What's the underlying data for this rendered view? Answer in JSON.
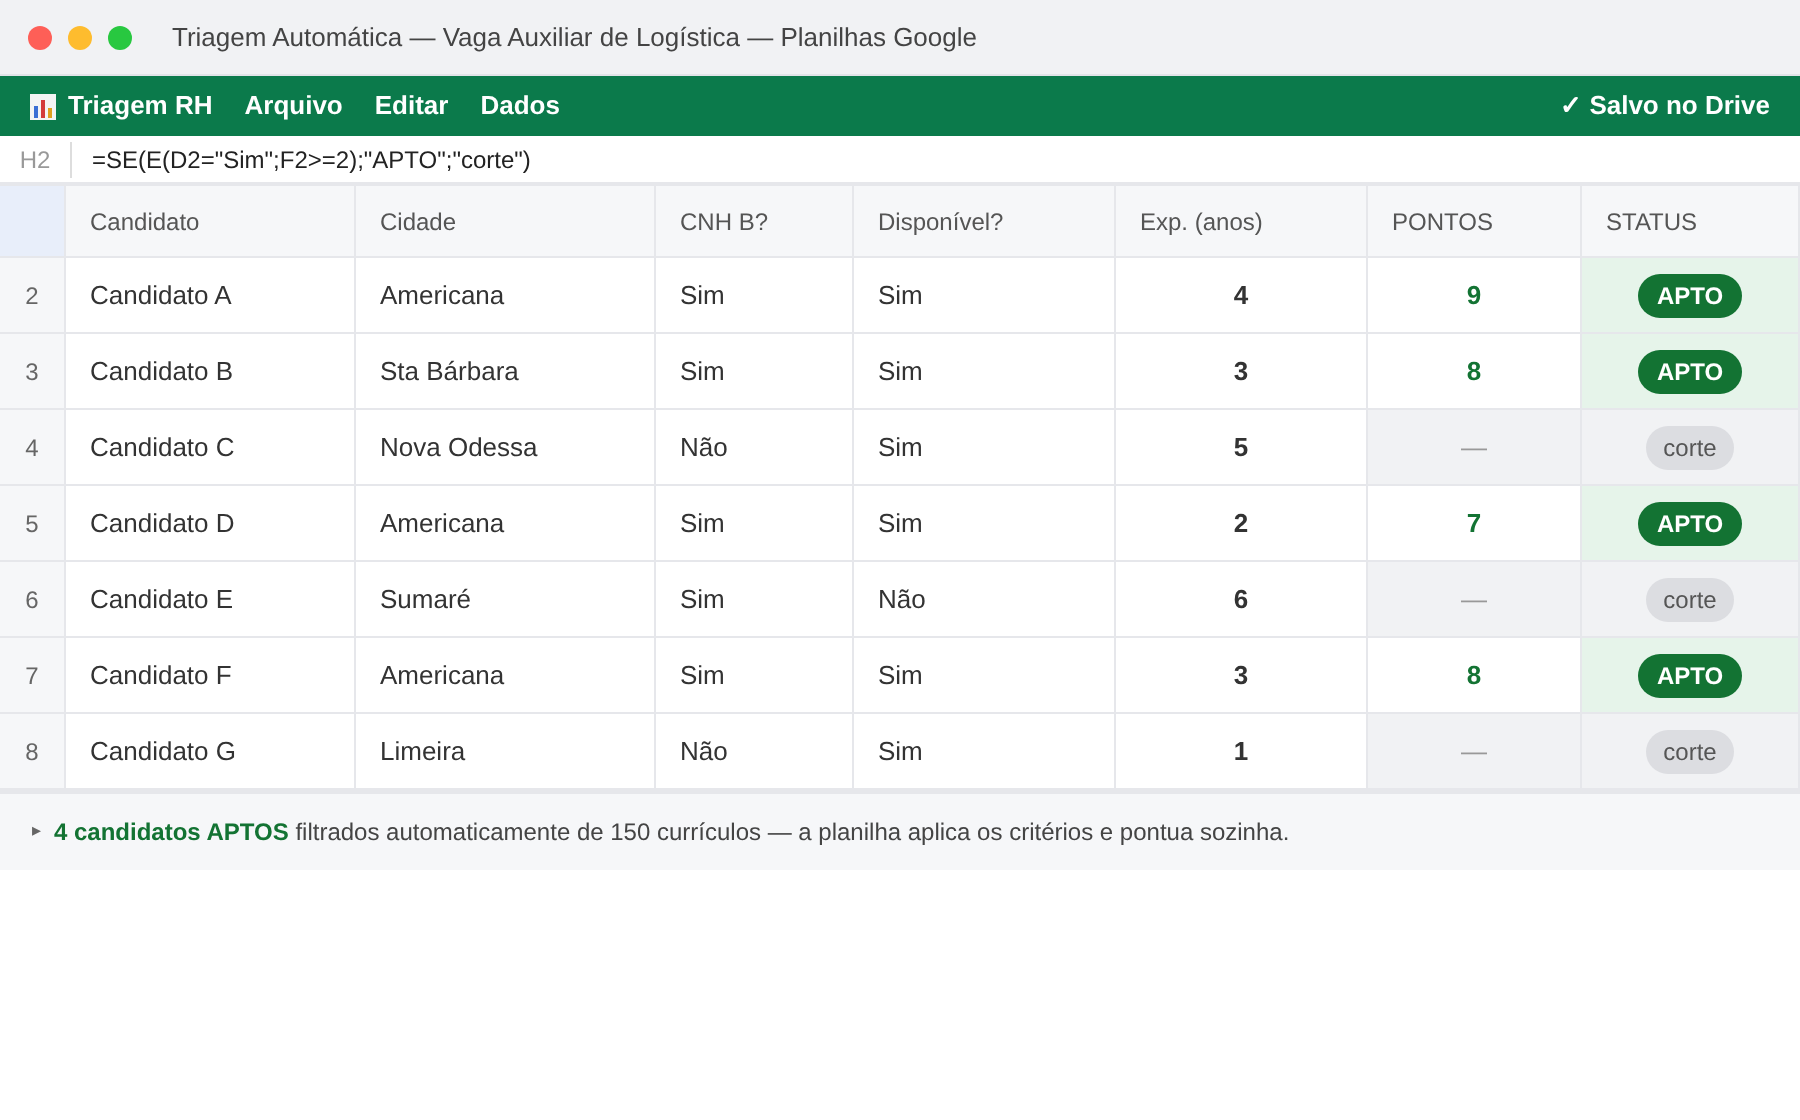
{
  "window": {
    "title": "Triagem Automática — Vaga Auxiliar de Logística — Planilhas Google"
  },
  "menu": {
    "brand": "Triagem RH",
    "items": [
      "Arquivo",
      "Editar",
      "Dados"
    ],
    "save_status": "✓ Salvo no Drive"
  },
  "formula_bar": {
    "cell": "H2",
    "formula": "=SE(E(D2=\"Sim\";F2>=2);\"APTO\";\"corte\")"
  },
  "table": {
    "columns": [
      "Candidato",
      "Cidade",
      "CNH B?",
      "Disponível?",
      "Exp. (anos)",
      "PONTOS",
      "STATUS"
    ],
    "rows": [
      {
        "row": "2",
        "kind": "apto",
        "cells": [
          "Candidato A",
          "Americana",
          "Sim",
          "Sim",
          "4",
          "9",
          "APTO"
        ]
      },
      {
        "row": "3",
        "kind": "apto",
        "cells": [
          "Candidato B",
          "Sta Bárbara",
          "Sim",
          "Sim",
          "3",
          "8",
          "APTO"
        ]
      },
      {
        "row": "4",
        "kind": "corte",
        "cells": [
          "Candidato C",
          "Nova Odessa",
          "Não",
          "Sim",
          "5",
          "—",
          "corte"
        ]
      },
      {
        "row": "5",
        "kind": "apto",
        "cells": [
          "Candidato D",
          "Americana",
          "Sim",
          "Sim",
          "2",
          "7",
          "APTO"
        ]
      },
      {
        "row": "6",
        "kind": "corte",
        "cells": [
          "Candidato E",
          "Sumaré",
          "Sim",
          "Não",
          "6",
          "—",
          "corte"
        ]
      },
      {
        "row": "7",
        "kind": "apto",
        "cells": [
          "Candidato F",
          "Americana",
          "Sim",
          "Sim",
          "3",
          "8",
          "APTO"
        ]
      },
      {
        "row": "8",
        "kind": "corte",
        "cells": [
          "Candidato G",
          "Limeira",
          "Não",
          "Sim",
          "1",
          "—",
          "corte"
        ]
      }
    ]
  },
  "footer": {
    "marker": "▸",
    "text": "**4 candidatos APTOS** filtrados automaticamente de 150 currículos — a planilha aplica os critérios e pontua sozinha."
  }
}
